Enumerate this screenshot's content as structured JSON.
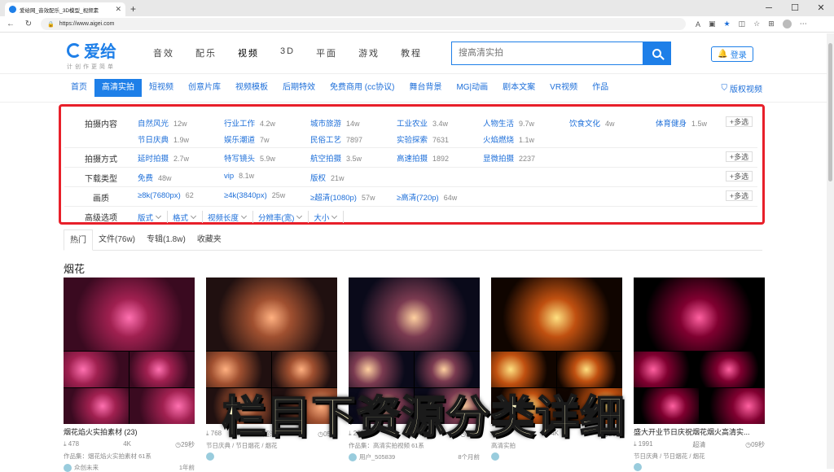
{
  "browser": {
    "tab_title": "爱给网_音效配乐_3D模型_视频素",
    "url": "https://www.aigei.com"
  },
  "header": {
    "logo_text": "爱给",
    "logo_sub": "计创作更简单",
    "nav": [
      "音效",
      "配乐",
      "视频",
      "3D",
      "平面",
      "游戏",
      "教程"
    ],
    "search_placeholder": "搜高清实拍",
    "login_label": "登录"
  },
  "subnav": {
    "items": [
      "首页",
      "高清实拍",
      "短视频",
      "创意片库",
      "视频模板",
      "后期特效",
      "免费商用 (cc协议)",
      "舞台背景",
      "MG|动画",
      "剧本文案",
      "VR视频",
      "作品"
    ],
    "right": "版权视频"
  },
  "filters": {
    "rows": [
      {
        "label": "拍摄内容",
        "options": [
          [
            "自然风光",
            "12w"
          ],
          [
            "行业工作",
            "4.2w"
          ],
          [
            "城市旅游",
            "14w"
          ],
          [
            "工业农业",
            "3.4w"
          ],
          [
            "人物生活",
            "9.7w"
          ],
          [
            "饮食文化",
            "4w"
          ],
          [
            "体育健身",
            "1.5w"
          ],
          [
            "节日庆典",
            "1.9w"
          ],
          [
            "娱乐潮道",
            "7w"
          ],
          [
            "民俗工艺",
            "7897"
          ],
          [
            "实验探索",
            "7631"
          ],
          [
            "火焰燃烧",
            "1.1w"
          ]
        ]
      },
      {
        "label": "拍摄方式",
        "options": [
          [
            "延时拍摄",
            "2.7w"
          ],
          [
            "特写镜头",
            "5.9w"
          ],
          [
            "航空拍摄",
            "3.5w"
          ],
          [
            "高速拍摄",
            "1892"
          ],
          [
            "显微拍摄",
            "2237"
          ]
        ]
      },
      {
        "label": "下载类型",
        "options": [
          [
            "免费",
            "48w"
          ],
          [
            "vip",
            "8.1w"
          ],
          [
            "版权",
            "21w"
          ]
        ]
      },
      {
        "label": "画质",
        "options": [
          [
            "≥8k(7680px)",
            "62"
          ],
          [
            "≥4k(3840px)",
            "25w"
          ],
          [
            "≥超清(1080p)",
            "57w"
          ],
          [
            "≥高清(720p)",
            "64w"
          ]
        ]
      }
    ],
    "multi_label": "+多选",
    "advanced_label": "高级选项",
    "advanced": [
      "版式",
      "格式",
      "视频长度",
      "分辨率(宽)",
      "大小"
    ]
  },
  "content_tabs": [
    "热门",
    "文件(76w)",
    "专辑(1.8w)",
    "收藏夹"
  ],
  "section_title": "烟花",
  "cards": [
    {
      "title": "烟花焰火实拍素材 (23)",
      "count": "478",
      "res": "4K",
      "dur": "29秒",
      "collection": "作品集：烟花焰火实拍素材 61系",
      "author": "众创未来",
      "time": "1年前"
    },
    {
      "title": "",
      "count": "768",
      "res": "超清",
      "dur": "05秒",
      "collection": "节日庆典 / 节日烟花 / 烟花",
      "author": "",
      "time": ""
    },
    {
      "title": "",
      "count": "203",
      "res": "超清",
      "dur": "12秒",
      "collection": "作品集：高清实拍视频 61系",
      "author": "用户_505839",
      "time": "8个月前"
    },
    {
      "title": "",
      "count": "576",
      "res": "4K",
      "dur": "26秒",
      "collection": "高清实拍",
      "author": "",
      "time": ""
    },
    {
      "title": "盛大开业节日庆祝烟花烟火高清实...",
      "count": "1991",
      "res": "超清",
      "dur": "09秒",
      "collection": "节日庆典 / 节日烟花 / 烟花",
      "author": "",
      "time": ""
    }
  ],
  "overlay_caption": "栏目下资源分类详细"
}
